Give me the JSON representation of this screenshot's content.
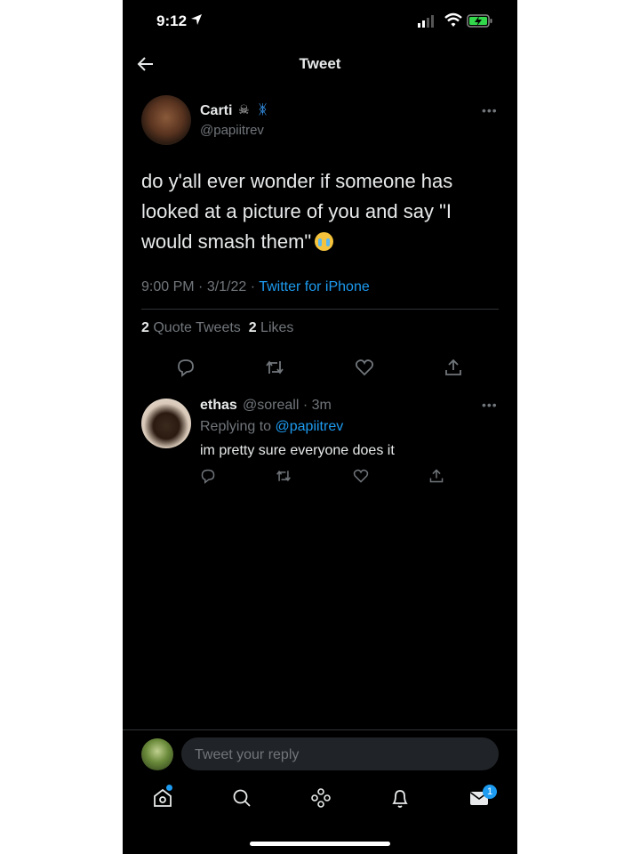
{
  "status_bar": {
    "time": "9:12"
  },
  "header": {
    "title": "Tweet"
  },
  "tweet": {
    "name": "Carti",
    "handle": "@papiitrev",
    "text": "do y'all ever wonder if someone has looked at a picture of you and say \"I would smash them\"",
    "time": "9:00 PM",
    "date": "3/1/22",
    "source": "Twitter for iPhone",
    "quote_count": "2",
    "quote_label": "Quote Tweets",
    "like_count": "2",
    "like_label": "Likes"
  },
  "reply": {
    "name": "ethas",
    "handle": "@soreall",
    "age": "3m",
    "replying_prefix": "Replying to",
    "replying_to": "@papiitrev",
    "text": "im pretty sure everyone does it"
  },
  "composer": {
    "placeholder": "Tweet your reply"
  },
  "nav": {
    "messages_badge": "1"
  },
  "icons": [
    "location-arrow-icon",
    "signal-icon",
    "wifi-icon",
    "battery-charging-icon",
    "back-arrow-icon",
    "more-icon",
    "reply-icon",
    "retweet-icon",
    "like-icon",
    "share-icon",
    "home-icon",
    "search-icon",
    "spaces-icon",
    "notifications-icon",
    "messages-icon"
  ],
  "colors": {
    "background": "#000000",
    "text": "#e7e9ea",
    "muted": "#71767b",
    "accent": "#1d9bf0",
    "divider": "#2f3336"
  }
}
